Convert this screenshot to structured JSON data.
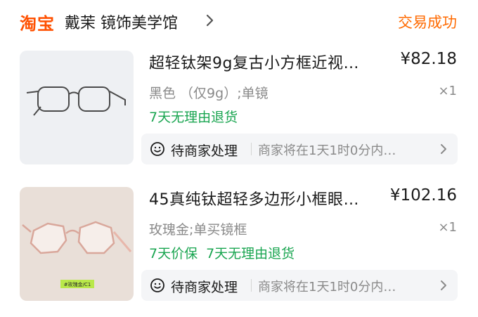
{
  "header": {
    "logo": "淘宝",
    "shop_name": "戴茉 镜饰美学馆",
    "status": "交易成功"
  },
  "items": [
    {
      "title": "超轻钛架9g复古小方框近视…",
      "price": "¥82.18",
      "spec": "黑色 （仅9g）;单镜",
      "qty": "×1",
      "guarantees": [
        "7天无理由退货"
      ],
      "service_status": "待商家处理",
      "service_desc": "商家将在1天1时0分内…",
      "thumb_tag": ""
    },
    {
      "title": "45真纯钛超轻多边形小框眼…",
      "price": "¥102.16",
      "spec": "玫瑰金;单买镜框",
      "qty": "×1",
      "guarantees": [
        "7天价保",
        "7天无理由退货"
      ],
      "service_status": "待商家处理",
      "service_desc": "商家将在1天1时0分内…",
      "thumb_tag": "#玫瑰金/C1"
    }
  ],
  "colors": {
    "brand": "#ff5000",
    "status": "#ff6a00",
    "guarantee": "#19a550"
  },
  "icons": [
    "chevron-right-icon",
    "smile-icon"
  ]
}
